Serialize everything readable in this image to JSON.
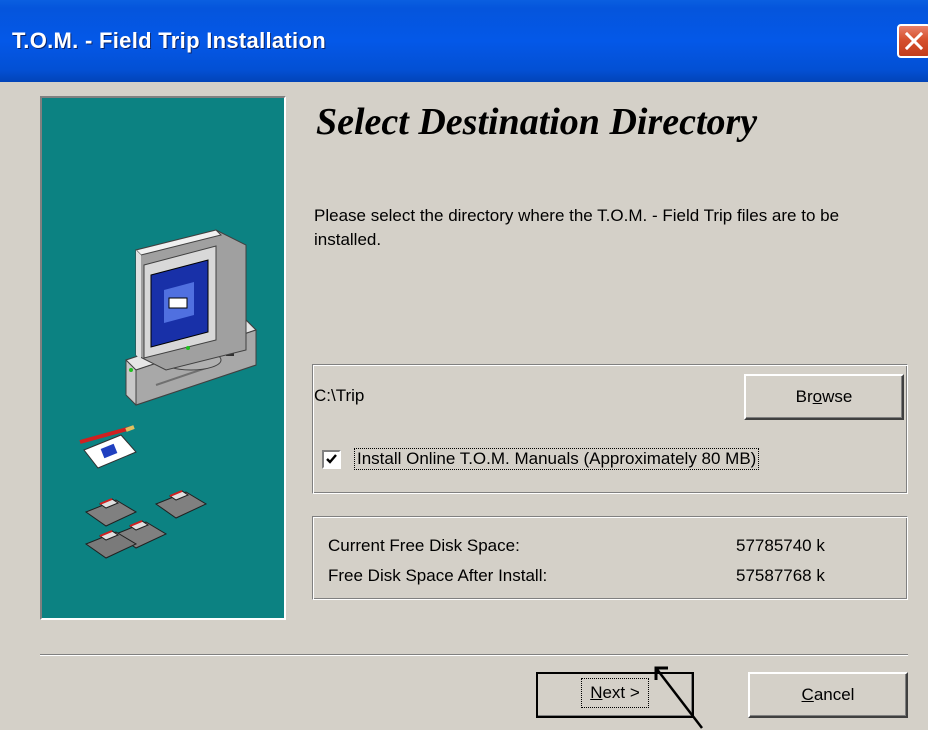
{
  "window": {
    "title": "T.O.M. - Field Trip Installation"
  },
  "page": {
    "heading": "Select Destination Directory",
    "description": "Please select the directory where the T.O.M. - Field Trip files are to be installed."
  },
  "destination": {
    "path": "C:\\Trip",
    "browse_label": "Browse",
    "install_manuals": {
      "checked": true,
      "label": "Install Online T.O.M. Manuals (Approximately 80 MB)"
    }
  },
  "disk": {
    "current_label": "Current Free Disk Space:",
    "current_value": "57785740 k",
    "after_label": "Free Disk Space After Install:",
    "after_value": "57587768 k"
  },
  "buttons": {
    "next_label": "Next >",
    "cancel_label": "Cancel"
  },
  "colors": {
    "titlebar": "#0458e8",
    "panel": "#0c8282",
    "face": "#d4d0c8",
    "close": "#d6512e"
  }
}
